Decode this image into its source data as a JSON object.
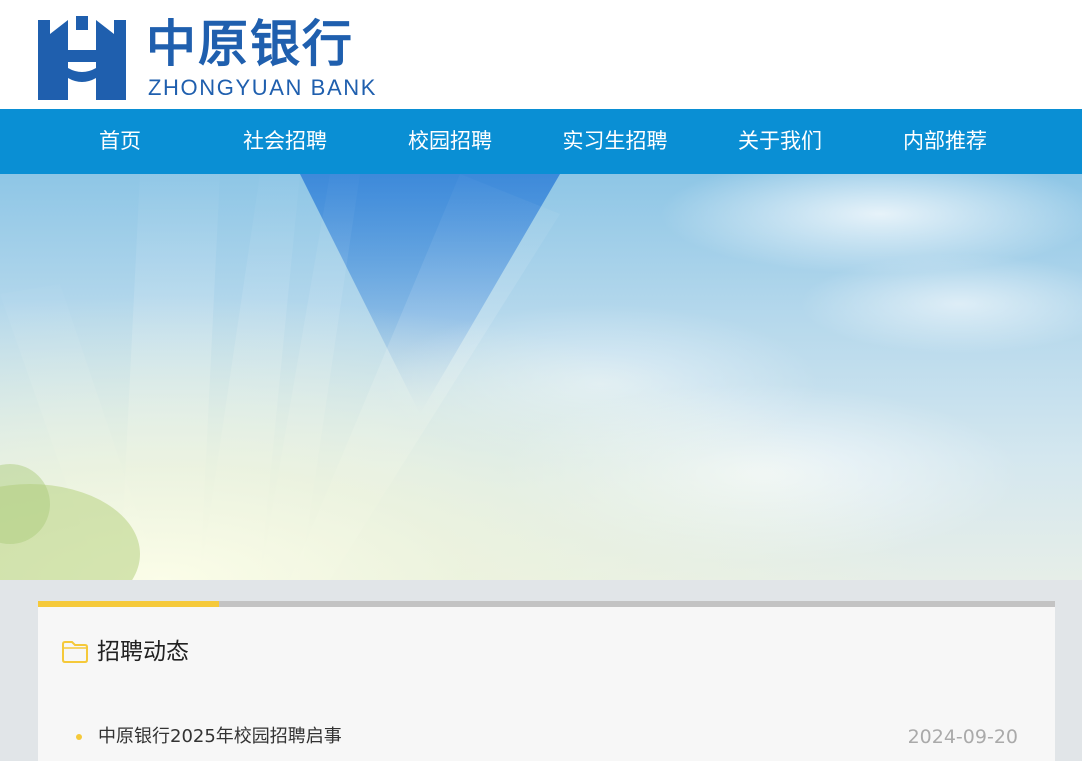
{
  "header": {
    "logo_cn": "中原银行",
    "logo_en": "ZHONGYUAN BANK",
    "brand_color": "#1f5fae"
  },
  "nav": {
    "bg_color": "#0a8fd4",
    "items": [
      {
        "label": "首页"
      },
      {
        "label": "社会招聘"
      },
      {
        "label": "校园招聘"
      },
      {
        "label": "实习生招聘"
      },
      {
        "label": "关于我们"
      },
      {
        "label": "内部推荐"
      }
    ]
  },
  "banner": {
    "icon": "sky-sunrays-image"
  },
  "news": {
    "section_title": "招聘动态",
    "section_icon": "folder-icon",
    "accent_color": "#f5c93a",
    "items": [
      {
        "title": "中原银行2025年校园招聘启事",
        "date": "2024-09-20"
      }
    ]
  }
}
